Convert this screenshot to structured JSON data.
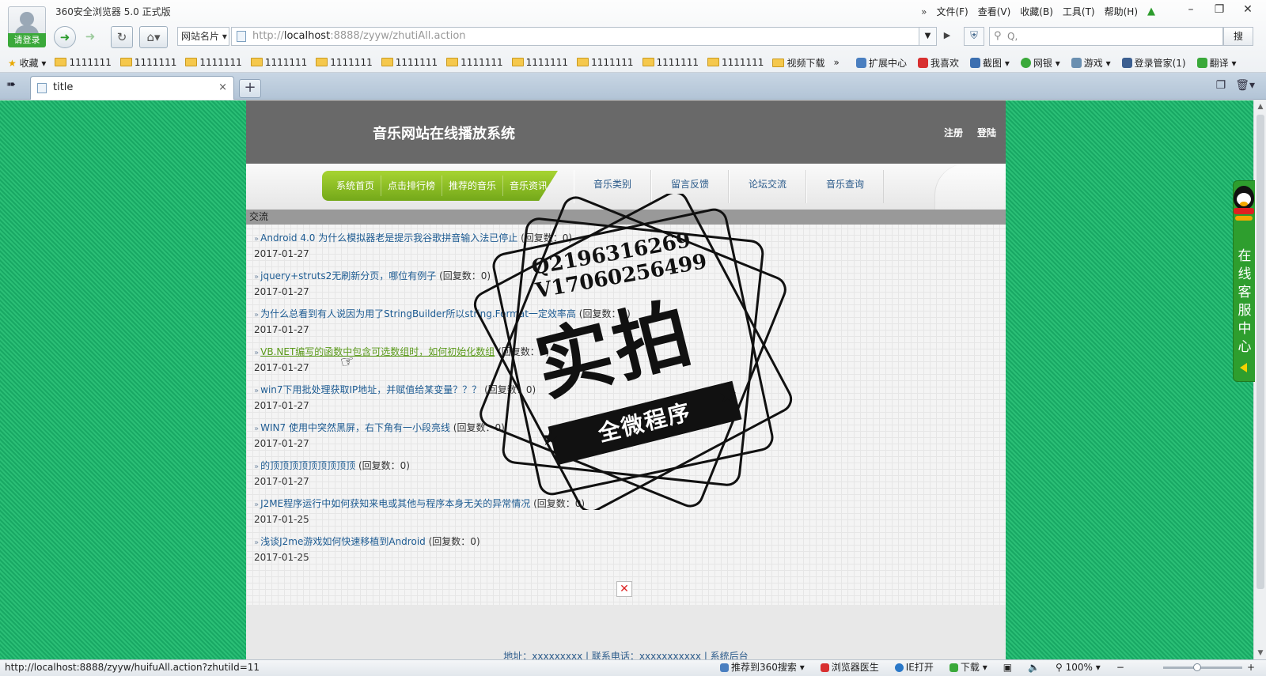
{
  "browser": {
    "app_title": "360安全浏览器 5.0 正式版",
    "login_label": "请登录",
    "menu": [
      "文件(F)",
      "查看(V)",
      "收藏(B)",
      "工具(T)",
      "帮助(H)"
    ],
    "menu_more": "»",
    "window_controls": [
      "–",
      "❐",
      "✕"
    ],
    "site_label": "网站名片",
    "address_prefix": "http://",
    "address_host": "localhost",
    "address_rest": ":8888/zyyw/zhutiAll.action",
    "search_placeholder": "Q,",
    "search_button": "搜",
    "favorites_label": "收藏",
    "bookmark_folders": [
      "1111111",
      "1111111",
      "1111111",
      "1111111",
      "1111111",
      "1111111",
      "1111111",
      "1111111",
      "1111111",
      "1111111",
      "1111111"
    ],
    "bookmark_video": "视频下载",
    "bookmark_more": "»",
    "toolbar_right": [
      "扩展中心",
      "我喜欢",
      "截图",
      "网银",
      "游戏",
      "登录管家(1)",
      "翻译"
    ],
    "tab_title": "title",
    "tab_close": "×",
    "new_tab": "+",
    "status_url": "http://localhost:8888/zyyw/huifuAll.action?zhutiId=11",
    "status_items": [
      "推荐到360搜索",
      "浏览器医生",
      "IE打开",
      "下载",
      "100%"
    ]
  },
  "site": {
    "title": "音乐网站在线播放系统",
    "register": "注册",
    "login": "登陆",
    "nav_primary": [
      "系统首页",
      "点击排行榜",
      "推荐的音乐",
      "音乐资讯"
    ],
    "nav_secondary": [
      "音乐类别",
      "留言反馈",
      "论坛交流",
      "音乐查询"
    ],
    "section_title": "交流",
    "reply_prefix": "(回复数：",
    "reply_suffix": ")",
    "topics": [
      {
        "title": "Android 4.0 为什么模拟器老是提示我谷歌拼音输入法已停止",
        "replies": "0",
        "date": "2017-01-27"
      },
      {
        "title": "jquery+struts2无刷新分页，哪位有例子",
        "replies": "0",
        "date": "2017-01-27"
      },
      {
        "title": "为什么总看到有人说因为用了StringBuilder所以string.Format一定效率高",
        "replies": "0",
        "date": "2017-01-27"
      },
      {
        "title": "VB.NET编写的函数中包含可选数组时，如何初始化数组",
        "replies": "0",
        "date": "2017-01-27"
      },
      {
        "title": "win7下用批处理获取IP地址，并赋值给某变量？？？",
        "replies": "0",
        "date": "2017-01-27"
      },
      {
        "title": "WIN7 使用中突然黑屏，右下角有一小段亮线",
        "replies": "0",
        "date": "2017-01-27"
      },
      {
        "title": "的顶顶顶顶顶顶顶顶顶",
        "replies": "0",
        "date": "2017-01-27"
      },
      {
        "title": "J2ME程序运行中如何获知来电或其他与程序本身无关的异常情况",
        "replies": "0",
        "date": "2017-01-25"
      },
      {
        "title": "浅谈J2me游戏如何快速移植到Android",
        "replies": "0",
        "date": "2017-01-25"
      }
    ],
    "footer": "地址：xxxxxxxxx | 联系电话：xxxxxxxxxxx | 系统后台"
  },
  "watermark": {
    "line1": "Q2196316269",
    "line2": "V17060256499",
    "big": "实拍",
    "ribbon": "全微程序"
  },
  "service": {
    "label": "在线客服中心"
  }
}
